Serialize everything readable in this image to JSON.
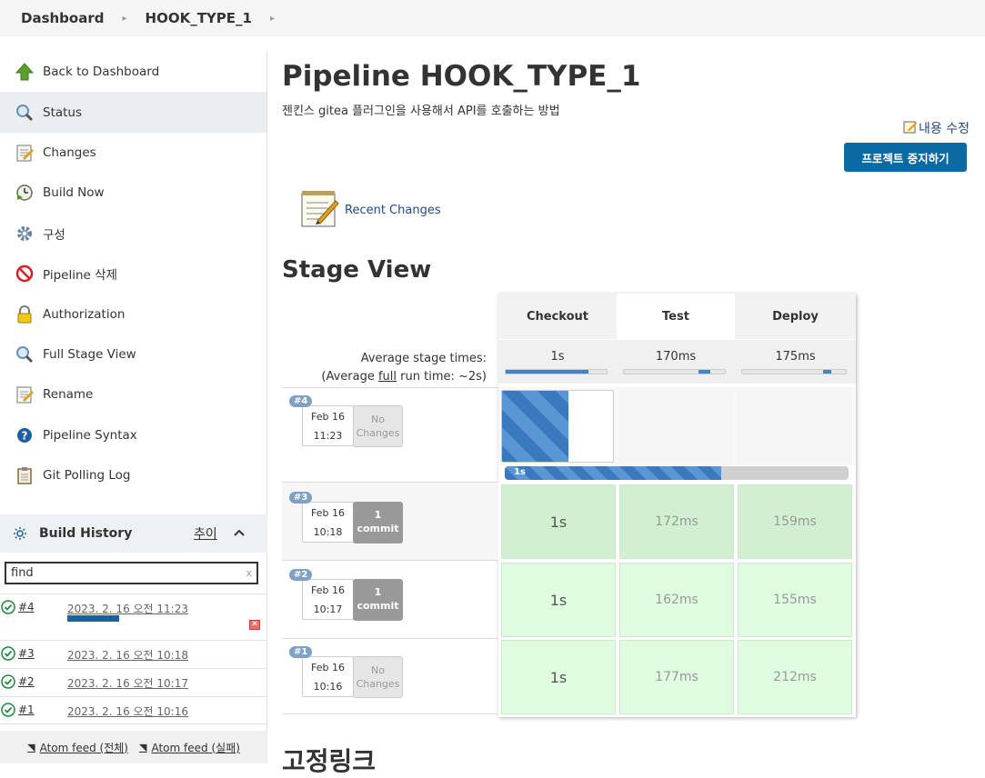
{
  "breadcrumb": {
    "items": [
      "Dashboard",
      "HOOK_TYPE_1"
    ]
  },
  "sidebar": {
    "items": [
      {
        "label": "Back to Dashboard",
        "icon": "arrow-up-icon"
      },
      {
        "label": "Status",
        "icon": "search-icon",
        "active": true
      },
      {
        "label": "Changes",
        "icon": "notepad-icon"
      },
      {
        "label": "Build Now",
        "icon": "clock-play-icon"
      },
      {
        "label": "구성",
        "icon": "gear-icon"
      },
      {
        "label": "Pipeline 삭제",
        "icon": "no-entry-icon"
      },
      {
        "label": "Authorization",
        "icon": "lock-icon"
      },
      {
        "label": "Full Stage View",
        "icon": "search-icon"
      },
      {
        "label": "Rename",
        "icon": "notepad-icon"
      },
      {
        "label": "Pipeline Syntax",
        "icon": "help-icon"
      },
      {
        "label": "Git Polling Log",
        "icon": "clipboard-icon"
      }
    ],
    "build_history": {
      "title": "Build History",
      "trend_label": "추이",
      "search_value": "find",
      "search_clear": "x",
      "builds": [
        {
          "num": "#4",
          "date": "2023. 2. 16 오전 11:23",
          "progress": 0.5
        },
        {
          "num": "#3",
          "date": "2023. 2. 16 오전 10:18"
        },
        {
          "num": "#2",
          "date": "2023. 2. 16 오전 10:17"
        },
        {
          "num": "#1",
          "date": "2023. 2. 16 오전 10:16"
        }
      ]
    },
    "feeds": [
      "Atom feed (전체)",
      "Atom feed (실패)"
    ]
  },
  "main": {
    "title": "Pipeline HOOK_TYPE_1",
    "description": "젠킨스 gitea 플러그인을 사용해서 API를 호출하는 방법",
    "edit_description": "내용 수정",
    "disable_button": "프로젝트 중지하기",
    "recent_changes": "Recent Changes",
    "stage_view_title": "Stage View",
    "permalinks_title": "고정링크",
    "stage_view": {
      "stages": [
        "Checkout",
        "Test",
        "Deploy"
      ],
      "avg_label_1": "Average stage times:",
      "avg_label_2_pre": "(Average ",
      "avg_label_2_link": "full",
      "avg_label_2_post": " run time: ~2s)",
      "avg_times": [
        "1s",
        "170ms",
        "175ms"
      ],
      "avg_fill": [
        0.82,
        0.12,
        0.08
      ],
      "running_progress_label": "1s",
      "running_progress": 0.63,
      "builds": [
        {
          "badge": "#4",
          "month_day": "Feb 16",
          "time": "11:23",
          "changes_1": "No",
          "changes_2": "Changes",
          "cells": []
        },
        {
          "badge": "#3",
          "month_day": "Feb 16",
          "time": "10:18",
          "changes_1": "1",
          "changes_2": "commit",
          "cells": [
            "1s",
            "172ms",
            "159ms"
          ]
        },
        {
          "badge": "#2",
          "month_day": "Feb 16",
          "time": "10:17",
          "changes_1": "1",
          "changes_2": "commit",
          "cells": [
            "1s",
            "162ms",
            "155ms"
          ]
        },
        {
          "badge": "#1",
          "month_day": "Feb 16",
          "time": "10:16",
          "changes_1": "No",
          "changes_2": "Changes",
          "cells": [
            "1s",
            "177ms",
            "212ms"
          ]
        }
      ]
    }
  },
  "colors": {
    "accent": "#0b6aa2",
    "success": "#e0fce0",
    "success_dark": "#d1f0d1",
    "running": "#3f86c9"
  }
}
